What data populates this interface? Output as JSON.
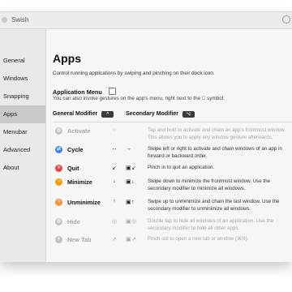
{
  "window": {
    "title": "Swish"
  },
  "sidebar": {
    "items": [
      {
        "label": "General",
        "active": false
      },
      {
        "label": "Windows",
        "active": false
      },
      {
        "label": "Snapping",
        "active": false
      },
      {
        "label": "Apps",
        "active": true
      },
      {
        "label": "Menubar",
        "active": false
      },
      {
        "label": "Advanced",
        "active": false
      },
      {
        "label": "About",
        "active": false
      }
    ]
  },
  "page": {
    "title": "Apps",
    "description": "Control running applications by swiping and pinching on their dock icon.",
    "app_menu_label": "Application Menu",
    "app_menu_checked": false,
    "app_menu_note": "You can also invoke gestures on the app's menu, right next to the  symbol.",
    "general_modifier_label": "General Modifier",
    "general_modifier_key": "^",
    "secondary_modifier_label": "Secondary Modifier",
    "secondary_modifier_key": "⌥"
  },
  "actions": [
    {
      "name": "Activate",
      "icon": "activate-icon",
      "icon_color": "#c2c2c2",
      "icon_glyph": "◎",
      "gesture": "○",
      "modifier": "",
      "desc1": "Tap and hold to activate and chain an app's frontmost window.",
      "desc2": "This allows you to apply any window gesture afterwards.",
      "dim": true
    },
    {
      "name": "Cycle",
      "icon": "cycle-icon",
      "icon_color": "#3b82f6",
      "icon_glyph": "⇄",
      "gesture": "↔",
      "modifier": "→",
      "desc1": "Swipe left or right to activate and chain windows of an app in",
      "desc2": "forward or backward order.",
      "dim": false
    },
    {
      "name": "Quit",
      "icon": "quit-icon",
      "icon_color": "#ef4444",
      "icon_glyph": "×",
      "gesture": "↙",
      "modifier": "▣↙",
      "desc1": "Pinch in to quit an application.",
      "desc2": "",
      "dim": false
    },
    {
      "name": "Minimize",
      "icon": "minimize-icon",
      "icon_color": "#f59e0b",
      "icon_glyph": "−",
      "gesture": "↓",
      "modifier": "▣↓",
      "desc1": "Swipe down to minimize the frontmost window. Use the",
      "desc2": "secondary modifier to minimize all windows.",
      "dim": false
    },
    {
      "name": "Unminimize",
      "icon": "unminimize-icon",
      "icon_color": "#fb923c",
      "icon_glyph": "+",
      "gesture": "↑",
      "modifier": "▣↑",
      "desc1": "Swipe up to unminimize and chain the last window. Use the",
      "desc2": "secondary modifier to unminimize all windows.",
      "dim": false
    },
    {
      "name": "Hide",
      "icon": "hide-icon",
      "icon_color": "#c2c2c2",
      "icon_glyph": "◎",
      "gesture": "◎",
      "modifier": "▣◎",
      "desc1": "Double tap to hide all windows of an application. Use the",
      "desc2": "secondary modifier to hide all other apps.",
      "dim": true
    },
    {
      "name": "New Tab",
      "icon": "new-tab-icon",
      "icon_color": "#c2c2c2",
      "icon_glyph": "+",
      "gesture": "↗",
      "modifier": "▣↗",
      "desc1": "Pinch out to open a new tab or window (⌘N).",
      "desc2": "",
      "dim": true
    }
  ]
}
